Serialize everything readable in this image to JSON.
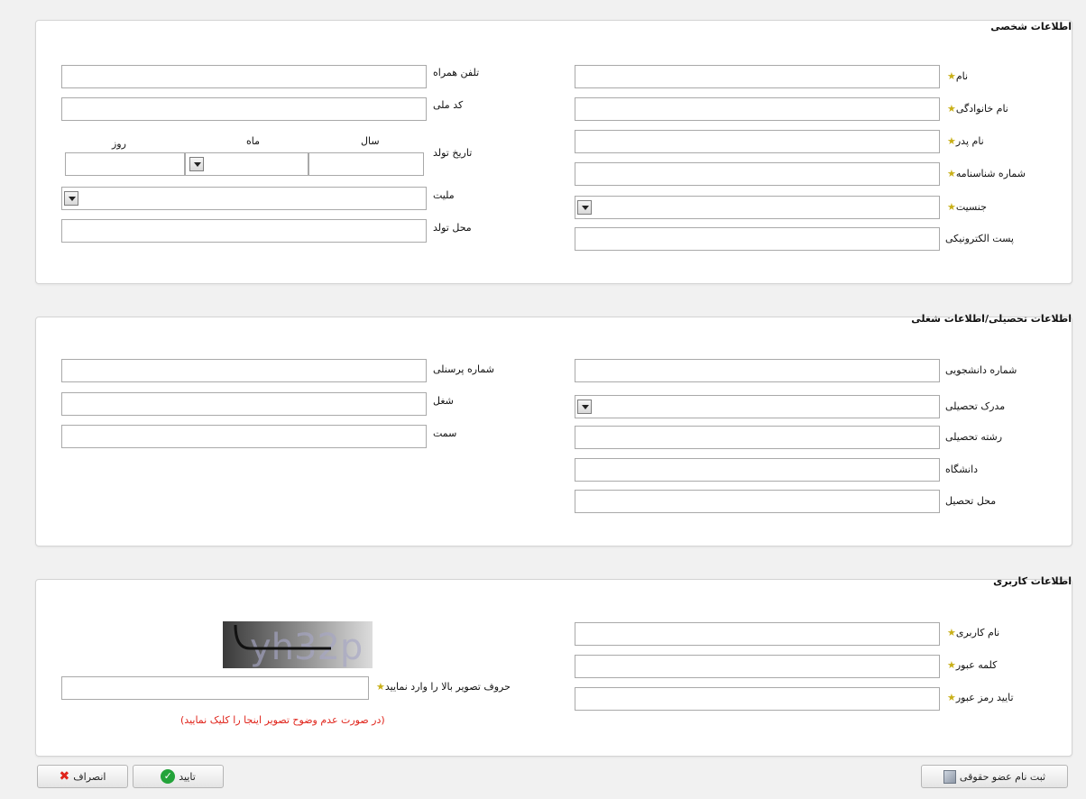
{
  "personal": {
    "title": "اطلاعات شخصی",
    "first_name_label": "نام",
    "last_name_label": "نام خانوادگی",
    "father_name_label": "نام پدر",
    "id_number_label": "شماره شناسنامه",
    "gender_label": "جنسیت",
    "email_label": "پست الکترونیکی",
    "mobile_label": "تلفن همراه",
    "national_code_label": "کد ملی",
    "birth_date_label": "تاریخ تولد",
    "year_label": "سال",
    "month_label": "ماه",
    "day_label": "روز",
    "nationality_label": "ملیت",
    "birth_place_label": "محل تولد"
  },
  "education": {
    "title": "اطلاعات تحصیلی/اطلاعات شغلی",
    "student_number_label": "شماره دانشجویی",
    "degree_label": "مدرک تحصیلی",
    "field_label": "رشته تحصیلی",
    "university_label": "دانشگاه",
    "study_place_label": "محل تحصیل",
    "personnel_number_label": "شماره پرسنلی",
    "job_label": "شغل",
    "position_label": "سمت"
  },
  "account": {
    "title": "اطلاعات کاربری",
    "username_label": "نام کاربری",
    "password_label": "کلمه عبور",
    "confirm_password_label": "تایید رمز عبور",
    "captcha_label": "حروف تصویر بالا را وارد نمایید",
    "captcha_text": "yh32p",
    "captcha_refresh_note": "(در صورت عدم وضوح تصویر اینجا را کلیک نمایید)"
  },
  "footer": {
    "legal_register_label": "ثبت نام عضو حقوقی",
    "confirm_label": "تایید",
    "cancel_label": "انصراف"
  },
  "required_marker": "★",
  "colors": {
    "required_star": "#c9b018",
    "error_red": "#e0241b",
    "ok_green": "#23a33a"
  }
}
